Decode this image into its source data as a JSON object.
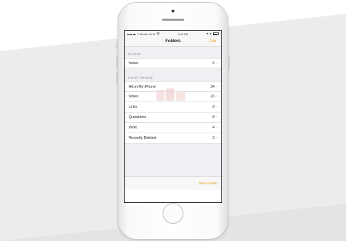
{
  "status_bar": {
    "carrier": "T-Mobile Wi-Fi",
    "time": "3:42 PM"
  },
  "nav": {
    "title": "Folders",
    "edit_label": "Edit"
  },
  "sections": {
    "icloud": {
      "header": "iCLOUD",
      "rows": [
        {
          "label": "Notes",
          "count": "5"
        }
      ]
    },
    "on_my_iphone": {
      "header": "ON MY iPHONE",
      "rows": [
        {
          "label": "All on My iPhone",
          "count": "34"
        },
        {
          "label": "Notes",
          "count": "20"
        },
        {
          "label": "Links",
          "count": "2"
        },
        {
          "label": "Quotations",
          "count": "8"
        },
        {
          "label": "Work",
          "count": "4"
        },
        {
          "label": "Recently Deleted",
          "count": "3"
        }
      ]
    }
  },
  "toolbar": {
    "new_folder_label": "New Folder"
  },
  "icons": {
    "signal": "signal-dots-icon",
    "wifi": "wifi-icon",
    "location": "location-arrow-icon",
    "bluetooth": "bluetooth-icon",
    "battery": "battery-icon",
    "chevron": "chevron-right-icon"
  },
  "colors": {
    "accent": "#e8a52b",
    "background": "#efeff4",
    "separator": "#e2e2e6",
    "section_header": "#8b8b90"
  }
}
